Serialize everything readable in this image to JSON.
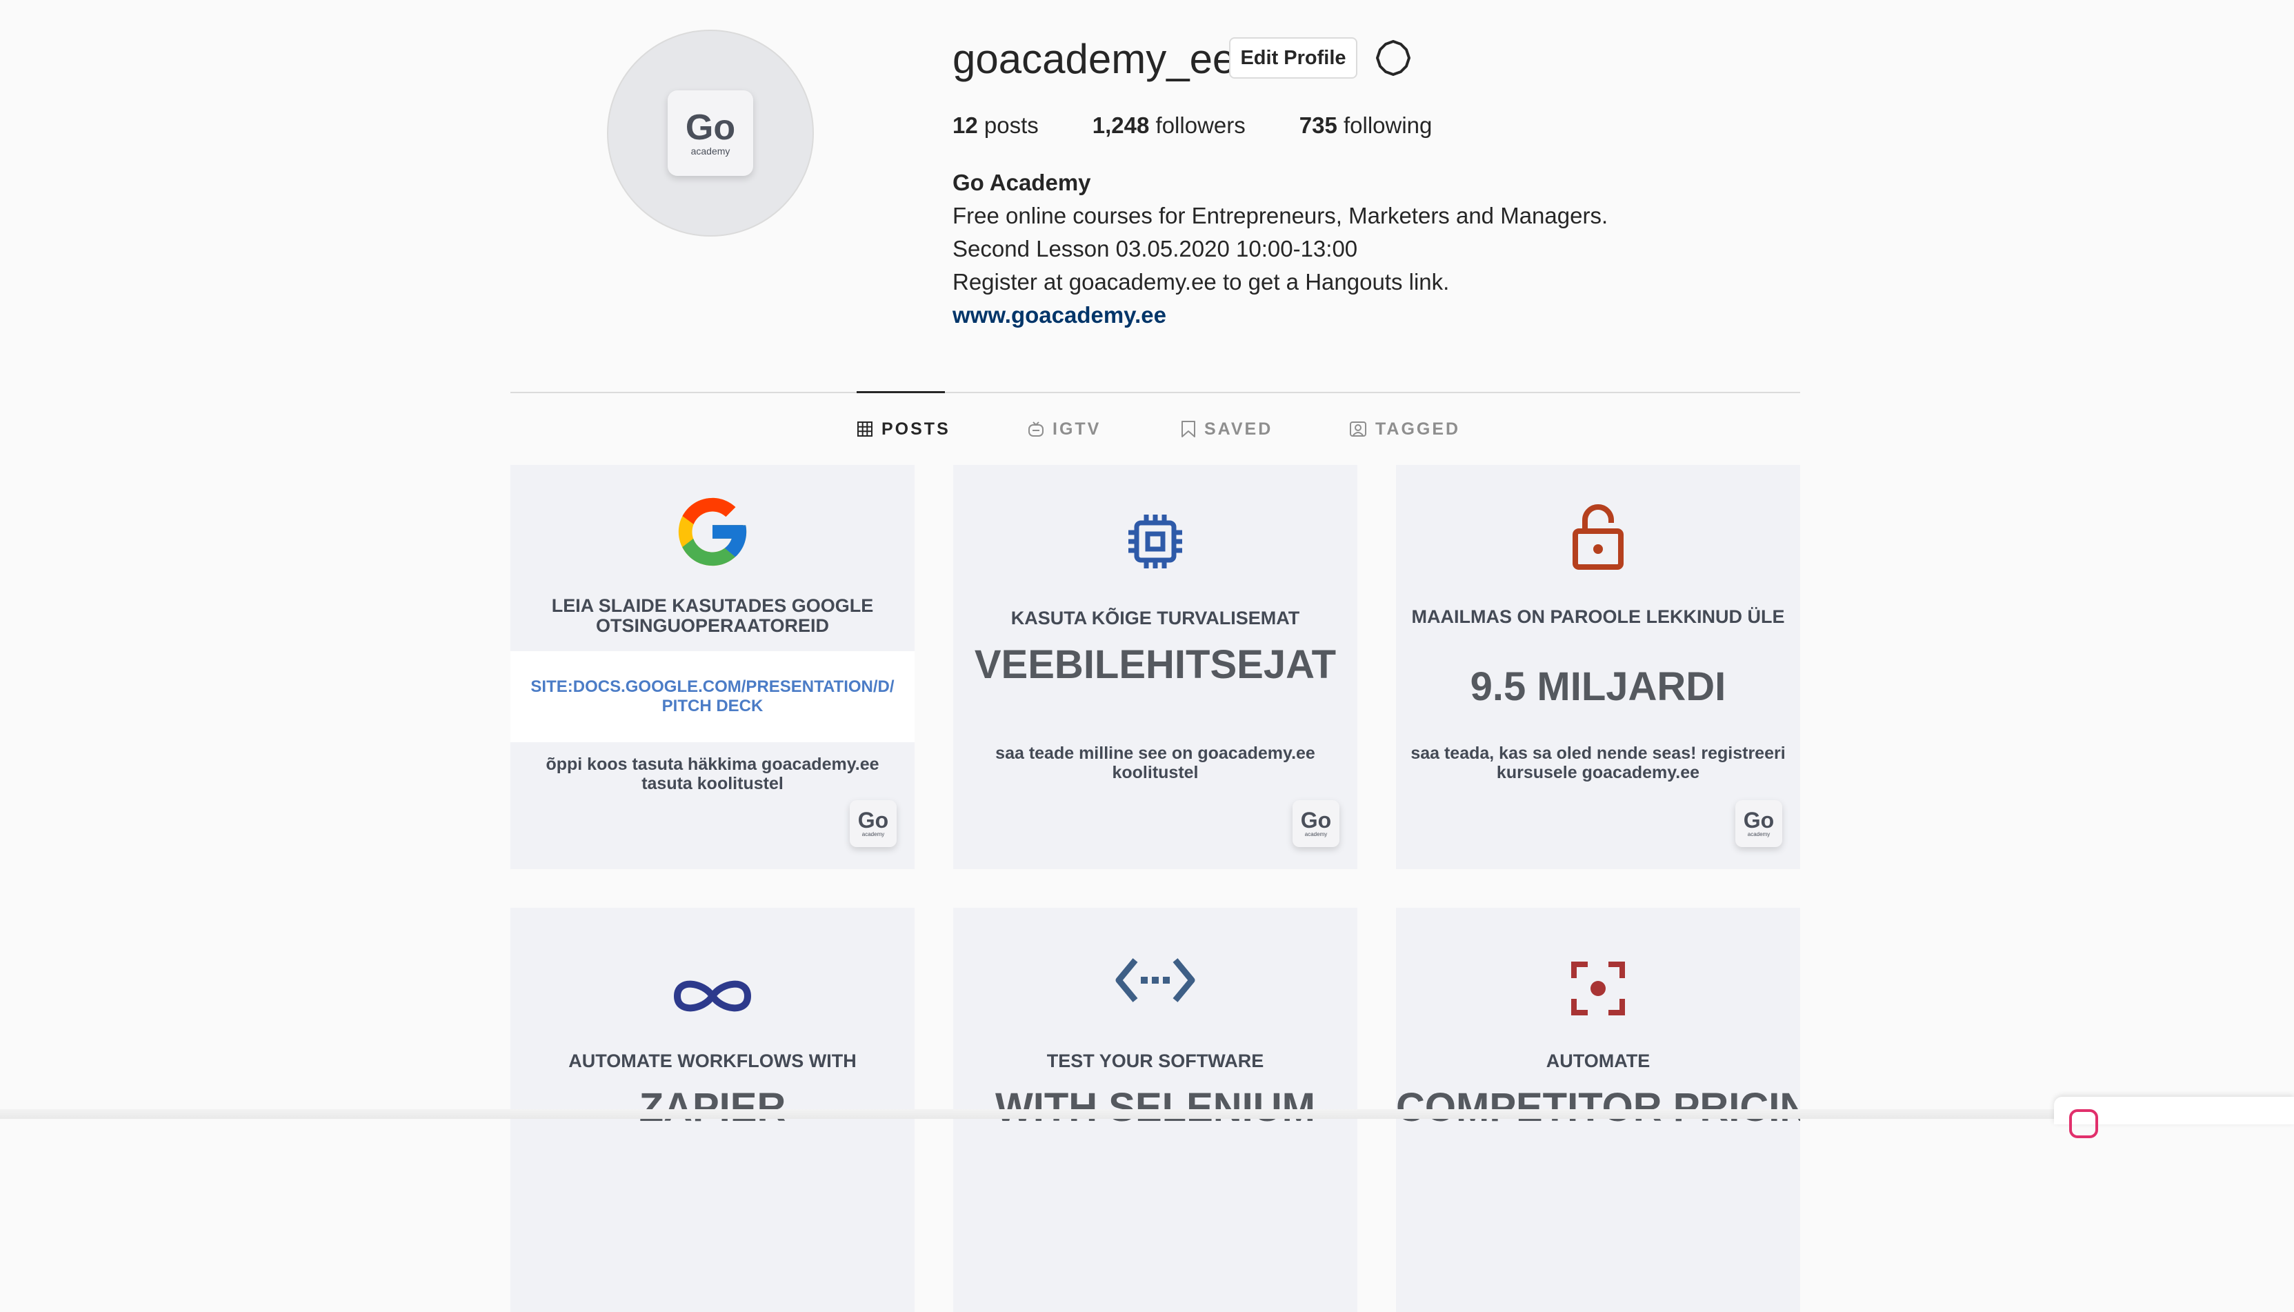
{
  "profile": {
    "username": "goacademy_ee",
    "edit_label": "Edit Profile",
    "avatar_logo": {
      "go": "Go",
      "sub": "academy"
    },
    "stats": {
      "posts_count": "12",
      "posts_label": "posts",
      "followers_count": "1,248",
      "followers_label": "followers",
      "following_count": "735",
      "following_label": "following"
    },
    "bio": {
      "name": "Go Academy",
      "lines": [
        "Free online courses for Entrepreneurs, Marketers and Managers.",
        "Second Lesson 03.05.2020 10:00-13:00",
        "Register at goacademy.ee to get a Hangouts link."
      ],
      "link": "www.goacademy.ee"
    }
  },
  "tabs": [
    {
      "label": "POSTS",
      "active": true
    },
    {
      "label": "IGTV"
    },
    {
      "label": "SAVED"
    },
    {
      "label": "TAGGED"
    }
  ],
  "posts": [
    {
      "icon": "google-g-icon",
      "heading": "LEIA SLAIDE KASUTADES GOOGLE OTSINGUOPERAATOREID",
      "url": "SITE:DOCS.GOOGLE.COM/PRESENTATION/D/ PITCH DECK",
      "caption": "õppi koos tasuta häkkima goacademy.ee tasuta koolitustel",
      "logo": {
        "go": "Go",
        "sub": "academy"
      }
    },
    {
      "icon": "chip-icon",
      "icon_color": "#2e5aa8",
      "heading": "KASUTA KÕIGE TURVALISEMAT",
      "big": "VEEBILEHITSEJAT",
      "caption": "saa teade milline see on goacademy.ee koolitustel",
      "logo": {
        "go": "Go",
        "sub": "academy"
      }
    },
    {
      "icon": "unlock-icon",
      "icon_color": "#b5401e",
      "heading": "MAAILMAS ON PAROOLE LEKKINUD ÜLE",
      "big": "9.5 MILJARDI",
      "caption": "saa teada, kas sa oled nende seas! registreeri kursusele goacademy.ee",
      "logo": {
        "go": "Go",
        "sub": "academy"
      }
    },
    {
      "icon": "infinity-icon",
      "icon_color": "#2d3a8c",
      "heading": "AUTOMATE WORKFLOWS WITH",
      "big": "ZAPIER"
    },
    {
      "icon": "code-arrows-icon",
      "icon_color": "#3e5f86",
      "heading": "TEST YOUR SOFTWARE",
      "big": "WITH SELENIUM"
    },
    {
      "icon": "focus-target-icon",
      "icon_color": "#a83434",
      "heading": "AUTOMATE",
      "big": "COMPETITOR PRICING"
    }
  ],
  "colors": {
    "link": "#003569",
    "url_blue": "#4b7cc6",
    "tile_bg": "#f1f2f6",
    "open_app_accent": "#e1306c"
  }
}
